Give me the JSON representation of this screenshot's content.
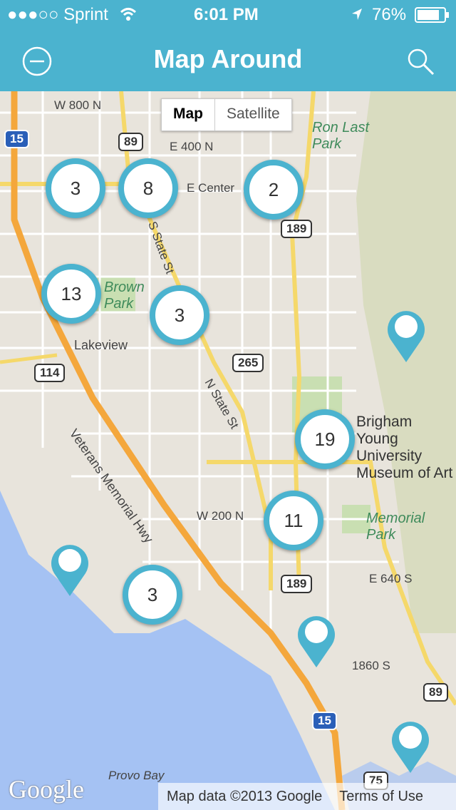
{
  "status": {
    "carrier": "●●●○○ Sprint",
    "time": "6:01 PM",
    "battery": "76%"
  },
  "nav": {
    "title": "Map Around",
    "left_icon": "minus-circle-icon",
    "right_icon": "search-icon"
  },
  "map_toggle": {
    "map": "Map",
    "satellite": "Satellite"
  },
  "clusters": [
    {
      "count": "3"
    },
    {
      "count": "8"
    },
    {
      "count": "2"
    },
    {
      "count": "13"
    },
    {
      "count": "3"
    },
    {
      "count": "19"
    },
    {
      "count": "11"
    },
    {
      "count": "3"
    }
  ],
  "map_labels": {
    "w800": "W 800 N",
    "e400": "E 400 N",
    "ecenter": "E Center",
    "lakeview": "Lakeview",
    "brown": "Brown Park",
    "ronlast": "Ron Last Park",
    "byu": "Brigham Young University Museum of Art",
    "memorial": "Memorial Park",
    "w200": "W 200 N",
    "e640": "E 640 S",
    "s1860": "1860 S",
    "veterans": "Veterans Memorial Hwy",
    "provobay": "Provo Bay",
    "nstate": "N State St",
    "sstate": "S State St"
  },
  "shields": {
    "i15a": "15",
    "us89a": "89",
    "us189a": "189",
    "r114": "114",
    "r265": "265",
    "us189b": "189",
    "us89b": "89",
    "i15b": "15",
    "r75": "75"
  },
  "footer": {
    "brand": "Google",
    "mapdata": "Map data ©2013 Google",
    "terms": "Terms of Use"
  },
  "colors": {
    "accent": "#4bb3cf",
    "water": "#a5c2f3",
    "highway": "#f4a73c",
    "park": "#c9dfb2"
  }
}
